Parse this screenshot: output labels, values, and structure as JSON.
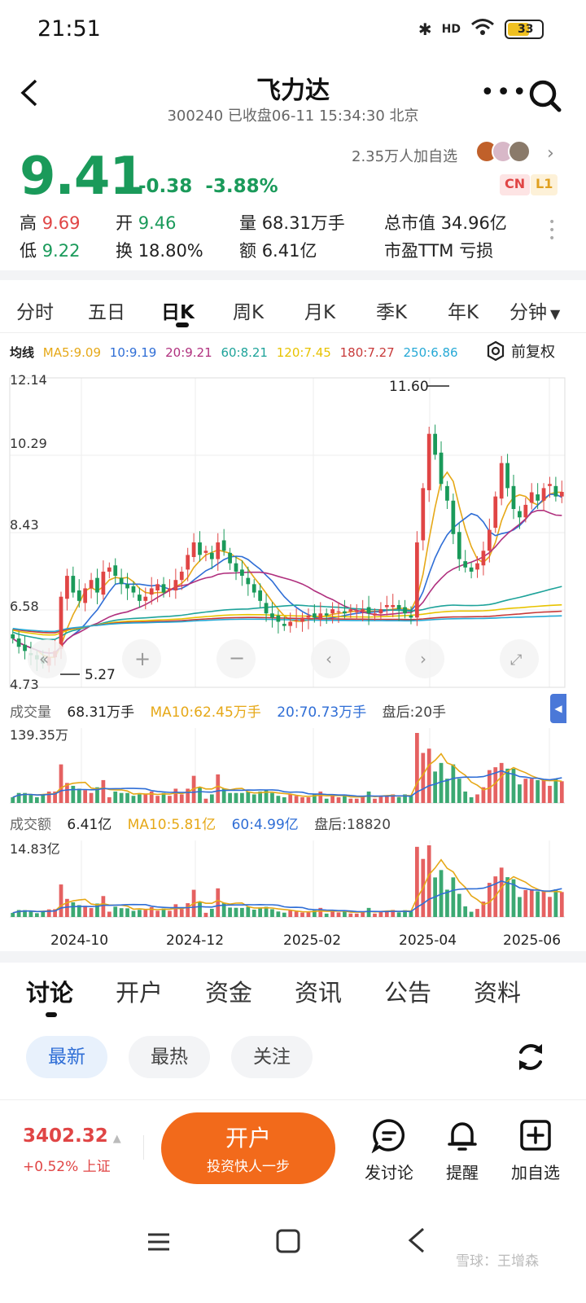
{
  "status": {
    "time": "21:51",
    "battery": "33",
    "hd": "HD"
  },
  "header": {
    "title": "飞力达",
    "subtitle": "300240 已收盘06-11 15:34:30 北京"
  },
  "quote": {
    "price": "9.41",
    "change": "-0.38",
    "change_pct": "-3.88%",
    "followers": "2.35万人加自选",
    "tag_cn": "CN",
    "tag_l1": "L1",
    "stats": {
      "high_label": "高",
      "high": "9.69",
      "open_label": "开",
      "open": "9.46",
      "volume_label": "量",
      "volume": "68.31万手",
      "mktcap_label": "总市值",
      "mktcap": "34.96亿",
      "low_label": "低",
      "low": "9.22",
      "turnover_label": "换",
      "turnover": "18.80%",
      "amount_label": "额",
      "amount": "6.41亿",
      "pe_label": "市盈TTM",
      "pe": "亏损"
    }
  },
  "period_tabs": [
    "分时",
    "五日",
    "日K",
    "周K",
    "月K",
    "季K",
    "年K",
    "分钟"
  ],
  "period_active": "日K",
  "ma_legend": {
    "label": "均线",
    "items": [
      {
        "text": "MA5:9.09",
        "color": "#e6a817"
      },
      {
        "text": "10:9.19",
        "color": "#2f6ed6"
      },
      {
        "text": "20:9.21",
        "color": "#b0307e"
      },
      {
        "text": "60:8.21",
        "color": "#1ea39a"
      },
      {
        "text": "120:7.45",
        "color": "#e8c300"
      },
      {
        "text": "180:7.27",
        "color": "#c83a3a"
      },
      {
        "text": "250:6.86",
        "color": "#26a9d6"
      }
    ],
    "adjust": "前复权"
  },
  "chart_data": {
    "type": "candlestick",
    "y_ticks": [
      "12.14",
      "10.29",
      "8.43",
      "6.58",
      "4.73"
    ],
    "ylim": [
      4.73,
      12.14
    ],
    "x_labels": [
      "2024-10",
      "2024-12",
      "2025-02",
      "2025-04",
      "2025-06"
    ],
    "max_label": "11.60",
    "min_label": "5.27",
    "volume": {
      "label": "成交量",
      "value": "68.31万手",
      "ma10": "MA10:62.45万手",
      "ma20": "20:70.73万手",
      "after": "盘后:20手",
      "top_tick": "139.35万"
    },
    "amount": {
      "label": "成交额",
      "value": "6.41亿",
      "ma10": "MA10:5.81亿",
      "ma60": "60:4.99亿",
      "after": "盘后:18820",
      "top_tick": "14.83亿"
    },
    "closes": [
      5.9,
      5.7,
      5.6,
      5.5,
      5.4,
      5.3,
      5.45,
      5.6,
      6.9,
      7.4,
      7.0,
      6.8,
      7.1,
      7.3,
      7.0,
      7.5,
      7.6,
      7.4,
      7.2,
      7.1,
      7.0,
      6.8,
      6.9,
      7.1,
      7.2,
      7.0,
      7.1,
      7.3,
      7.5,
      7.9,
      8.2,
      7.9,
      8.0,
      7.8,
      8.2,
      8.0,
      7.7,
      7.5,
      7.4,
      7.2,
      7.0,
      6.8,
      6.5,
      6.4,
      6.3,
      6.2,
      6.3,
      6.35,
      6.4,
      6.45,
      6.4,
      6.5,
      6.45,
      6.6,
      6.55,
      6.5,
      6.6,
      6.55,
      6.6,
      6.5,
      6.5,
      6.6,
      6.7,
      6.7,
      6.6,
      6.5,
      6.4,
      8.2,
      9.5,
      10.8,
      10.3,
      9.6,
      9.2,
      8.4,
      7.8,
      7.6,
      7.5,
      7.7,
      8.0,
      8.5,
      9.3,
      10.1,
      9.5,
      9.0,
      8.8,
      9.1,
      9.4,
      9.2,
      9.5,
      9.6,
      9.3,
      9.41
    ]
  },
  "news_tabs": [
    "讨论",
    "开户",
    "资金",
    "资讯",
    "公告",
    "资料"
  ],
  "news_active": "讨论",
  "filter_chips": [
    "最新",
    "最热",
    "关注"
  ],
  "bottom": {
    "index_value": "3402.32",
    "index_change": "+0.52% 上证",
    "open_title": "开户",
    "open_sub": "投资快人一步",
    "actions": [
      "发讨论",
      "提醒",
      "加自选"
    ]
  },
  "watermark": "雪球：王增森",
  "colors": {
    "up": "#e04545",
    "down": "#1a9a5a",
    "accent": "#f26a1b",
    "link": "#2f6ed6"
  }
}
